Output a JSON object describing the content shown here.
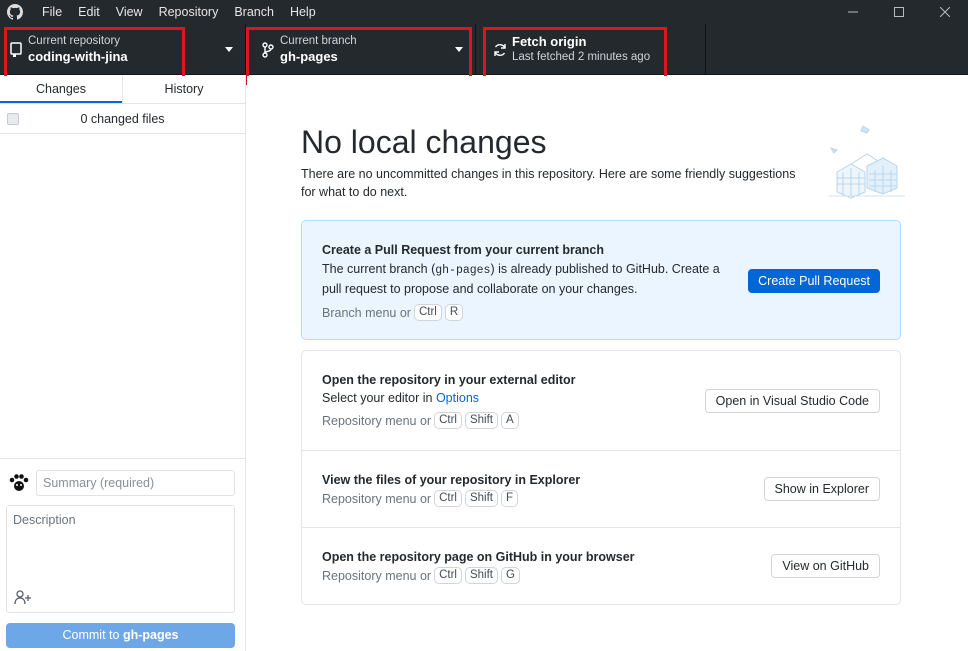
{
  "menu": [
    "File",
    "Edit",
    "View",
    "Repository",
    "Branch",
    "Help"
  ],
  "toolbar": {
    "repo_sub": "Current repository",
    "repo_name": "coding-with-jina",
    "branch_sub": "Current branch",
    "branch_name": "gh-pages",
    "fetch_main": "Fetch origin",
    "fetch_sub": "Last fetched 2 minutes ago"
  },
  "sidebar": {
    "tabs": [
      "Changes",
      "History"
    ],
    "changes_count": "0 changed files",
    "summary_placeholder": "Summary (required)",
    "description_placeholder": "Description",
    "commit_prefix": "Commit to ",
    "commit_branch": "gh-pages"
  },
  "main": {
    "heading": "No local changes",
    "subtext": "There are no uncommitted changes in this repository. Here are some friendly suggestions for what to do next.",
    "pull_request": {
      "title": "Create a Pull Request from your current branch",
      "desc_part1": "The current branch (",
      "desc_branch": "gh-pages",
      "desc_part2": ") is already published to GitHub. Create a pull request to propose and collaborate on your changes.",
      "shortcut_prefix": "Branch menu or",
      "keys": [
        "Ctrl",
        "R"
      ],
      "button": "Create Pull Request"
    },
    "editor": {
      "title": "Open the repository in your external editor",
      "desc": "Select your editor in ",
      "desc_link": "Options",
      "shortcut_prefix": "Repository menu or",
      "keys": [
        "Ctrl",
        "Shift",
        "A"
      ],
      "button": "Open in Visual Studio Code"
    },
    "explorer": {
      "title": "View the files of your repository in Explorer",
      "shortcut_prefix": "Repository menu or",
      "keys": [
        "Ctrl",
        "Shift",
        "F"
      ],
      "button": "Show in Explorer"
    },
    "github": {
      "title": "Open the repository page on GitHub in your browser",
      "shortcut_prefix": "Repository menu or",
      "keys": [
        "Ctrl",
        "Shift",
        "G"
      ],
      "button": "View on GitHub"
    }
  },
  "colors": {
    "toolbar_bg": "#24292e",
    "highlight": "#e0151c",
    "primary": "#0366d6",
    "commit_disabled": "#6ea7e8"
  }
}
